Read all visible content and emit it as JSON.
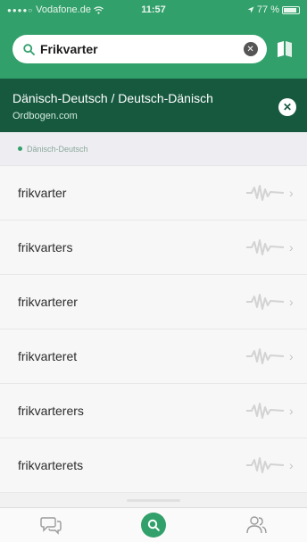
{
  "status_bar": {
    "carrier": "Vodafone.de",
    "time": "11:57",
    "battery": "77 %"
  },
  "search": {
    "query": "Frikvarter",
    "clear_icon": "clear-circle-icon",
    "book_icon": "book-icon"
  },
  "dictionary": {
    "title": "Dänisch-Deutsch / Deutsch-Dänisch",
    "source": "Ordbogen.com",
    "close_icon": "close-circle-icon"
  },
  "section": {
    "label": "Dänisch-Deutsch"
  },
  "results": [
    {
      "word": "frikvarter"
    },
    {
      "word": "frikvarters"
    },
    {
      "word": "frikvarterer"
    },
    {
      "word": "frikvarteret"
    },
    {
      "word": "frikvarterers"
    },
    {
      "word": "frikvarterets"
    }
  ],
  "tabs": [
    {
      "icon": "chat-bubbles-icon"
    },
    {
      "icon": "search-icon",
      "active": true
    },
    {
      "icon": "users-icon"
    }
  ],
  "colors": {
    "brand_green": "#32a06b",
    "banner_dark_green": "#16593f"
  }
}
